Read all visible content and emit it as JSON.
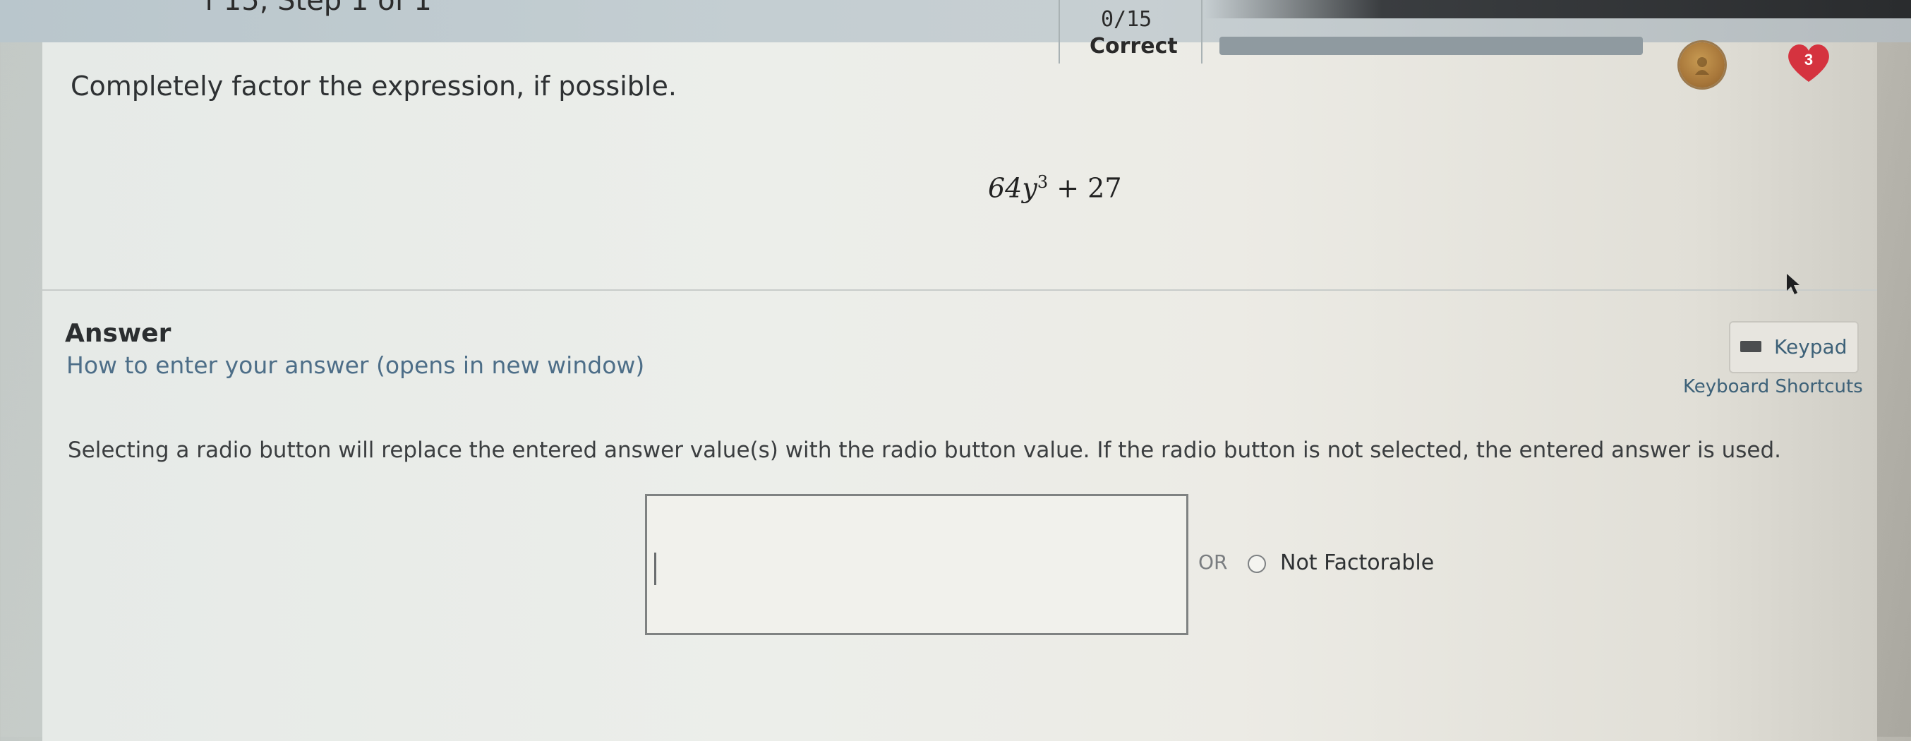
{
  "header": {
    "step_title": "f 15, Step 1 of 1",
    "score": "0/15",
    "status": "Correct",
    "progress_fraction": 0.0,
    "hearts_count": "3"
  },
  "question": {
    "prompt": "Completely factor the expression, if possible.",
    "expression": {
      "coef": "64",
      "var": "y",
      "exp": "3",
      "op": "+",
      "const": "27"
    }
  },
  "answer": {
    "heading": "Answer",
    "help_link": "How to enter your answer (opens in new window)",
    "keypad_label": "Keypad",
    "shortcuts_label": "Keyboard Shortcuts",
    "instruction": "Selecting a radio button will replace the entered answer value(s) with the radio button value. If the radio button is not selected, the entered answer is used.",
    "input_value": "",
    "or_label": "OR",
    "radio_label": "Not Factorable",
    "radio_selected": false
  },
  "colors": {
    "link": "#4d6e88",
    "heart": "#d5333f",
    "badge": "#a8773a"
  },
  "icons": {
    "badge": "avatar-medal-icon",
    "heart": "heart-icon",
    "keypad": "keyboard-icon",
    "cursor": "mouse-cursor-icon"
  }
}
